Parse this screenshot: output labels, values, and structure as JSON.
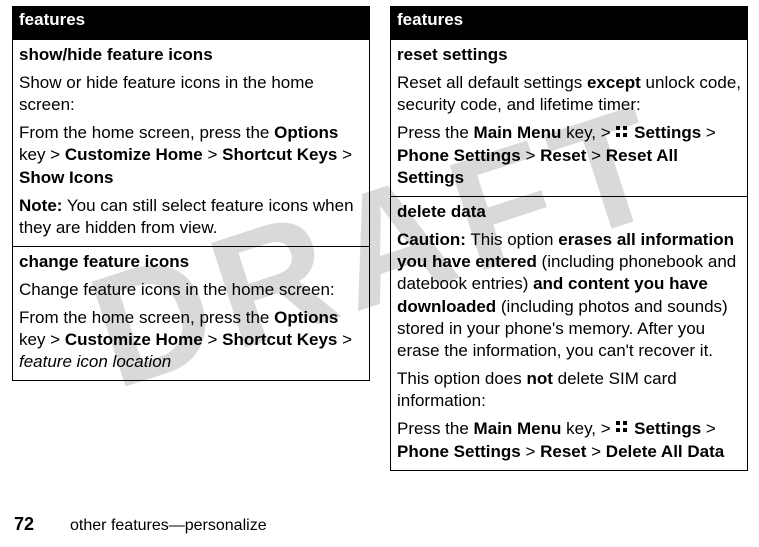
{
  "watermark": "DRAFT",
  "left": {
    "header": "features",
    "row1": {
      "title": "show/hide feature icons",
      "p1": "Show or hide feature icons in the home screen:",
      "p2a": "From the home screen, press the ",
      "p2b": "Options",
      "p2c": " key > ",
      "p2d": "Customize Home",
      "p2e": " > ",
      "p2f": "Shortcut Keys",
      "p2g": " > ",
      "p2h": "Show Icons",
      "p3a": "Note:",
      "p3b": " You can still select feature icons when they are hidden from view."
    },
    "row2": {
      "title": "change feature icons",
      "p1": "Change feature icons in the home screen:",
      "p2a": "From the home screen, press the ",
      "p2b": "Options",
      "p2c": " key > ",
      "p2d": "Customize Home",
      "p2e": " > ",
      "p2f": "Shortcut Keys",
      "p2g": " > ",
      "p2h": "feature icon location"
    }
  },
  "right": {
    "header": "features",
    "row1": {
      "title": "reset settings",
      "p1a": "Reset all default settings ",
      "p1b": "except",
      "p1c": " unlock code, security code, and lifetime timer:",
      "p2a": "Press the ",
      "p2b": "Main Menu",
      "p2c": " key, > ",
      "p2d": "Settings",
      "p2e": " > ",
      "p2f": "Phone Settings",
      "p2g": " > ",
      "p2h": "Reset",
      "p2i": " > ",
      "p2j": "Reset All Settings"
    },
    "row2": {
      "title": "delete data",
      "p1a": "Caution:",
      "p1b": " This option ",
      "p1c": "erases all information you have entered",
      "p1d": " (including phonebook and datebook entries) ",
      "p1e": "and content you have downloaded",
      "p1f": " (including photos and sounds) stored in your phone's memory. After you erase the information, you can't recover it.",
      "p2a": "This option does ",
      "p2b": "not",
      "p2c": " delete SIM card information:",
      "p3a": "Press the ",
      "p3b": "Main Menu",
      "p3c": " key, > ",
      "p3d": "Settings",
      "p3e": " > ",
      "p3f": "Phone Settings",
      "p3g": " > ",
      "p3h": "Reset",
      "p3i": " > ",
      "p3j": "Delete All Data"
    }
  },
  "footer": {
    "page": "72",
    "text": "other features—personalize"
  }
}
